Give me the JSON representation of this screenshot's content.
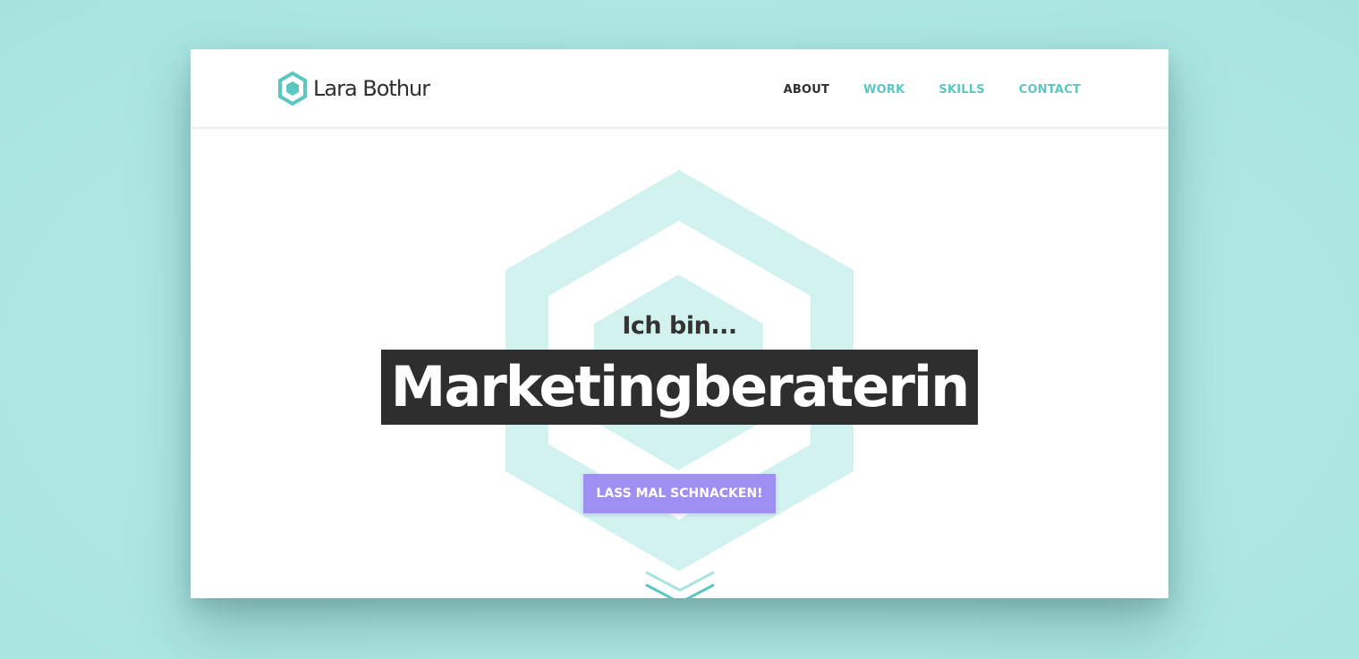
{
  "site": {
    "name": "Lara Bothur",
    "logo_icon": "hexagon-logo-icon"
  },
  "nav": {
    "items": [
      {
        "label": "ABOUT",
        "active": true
      },
      {
        "label": "WORK",
        "active": false
      },
      {
        "label": "SKILLS",
        "active": false
      },
      {
        "label": "CONTACT",
        "active": false
      }
    ]
  },
  "hero": {
    "intro": "Ich bin...",
    "headline": "Marketingberaterin",
    "cta_label": "LASS MAL SCHNACKEN!",
    "scroll_icon": "chevron-down-icon"
  },
  "colors": {
    "background": "#b1eae6",
    "accent": "#5bc7c1",
    "hex_light": "#d2f2f0",
    "headline_bg": "#2e2e2e",
    "cta": "#9f8ff0",
    "text_dark": "#2f2f2f"
  }
}
